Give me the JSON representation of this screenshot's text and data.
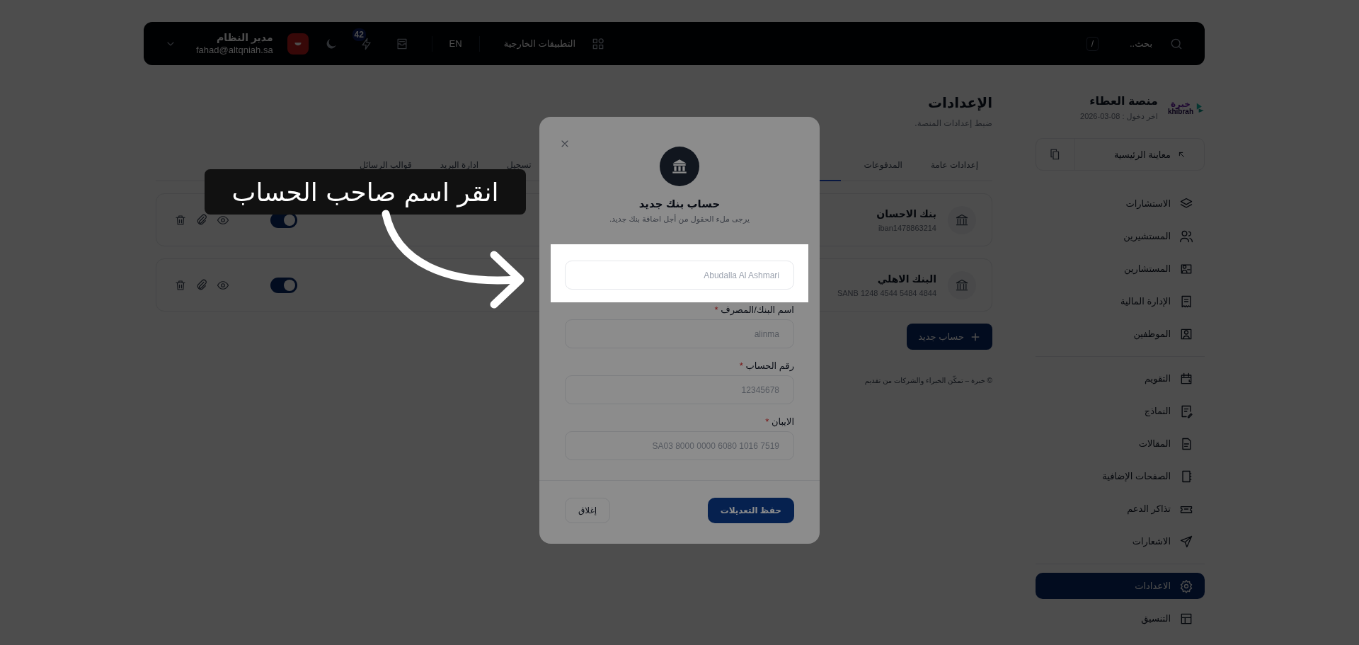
{
  "topbar": {
    "search": {
      "placeholder": "بحث..",
      "shortcut": "/"
    },
    "apps_link": "التطبيقات الخارجية",
    "language": "EN",
    "notifications_badge": "42",
    "user": {
      "name": "مدير النظام",
      "email": "fahad@altqniah.sa"
    }
  },
  "sidebar": {
    "logo_text": "خبرة",
    "logo_subtext": "khibrah",
    "title": "منصة العطاء",
    "last_login": "اخر دخول : 08-03-2026",
    "preview_button": "معاينة الرئيسية",
    "groups": [
      {
        "items": [
          {
            "label": "الاستشارات",
            "selected": false
          },
          {
            "label": "المستشيرين",
            "selected": false
          },
          {
            "label": "المستشارين",
            "selected": false
          },
          {
            "label": "الإدارة المالية",
            "selected": false
          },
          {
            "label": "الموظفين",
            "selected": false
          }
        ]
      },
      {
        "items": [
          {
            "label": "التقويم",
            "selected": false
          },
          {
            "label": "النماذج",
            "selected": false
          },
          {
            "label": "المقالات",
            "selected": false
          },
          {
            "label": "الصفحات الإضافية",
            "selected": false
          },
          {
            "label": "تذاكر الدعم",
            "selected": false
          },
          {
            "label": "الاشعارات",
            "selected": false
          }
        ]
      },
      {
        "items": [
          {
            "label": "الاعدادات",
            "selected": true
          },
          {
            "label": "التنسيق",
            "selected": false
          }
        ]
      }
    ]
  },
  "page": {
    "title": "الإعدادات",
    "subtitle": "ضبط إعدادات المنصة.",
    "tabs": [
      {
        "label": "إعدادات عامة",
        "selected": false
      },
      {
        "label": "المدفوعات",
        "selected": false
      },
      {
        "label": "تسجيل",
        "selected": false
      },
      {
        "label": "ادارة البريد",
        "selected": false
      },
      {
        "label": "قوالب الرسائل",
        "selected": false
      }
    ],
    "bank_accounts": [
      {
        "name": "بنك الاحسان",
        "iban": "iban1478863214",
        "active": true
      },
      {
        "name": "البنك الاهلي",
        "iban": "SANB 1248 4544 5484 4844",
        "active": true
      }
    ],
    "add_button": "حساب جديد",
    "footer": "© خبرة – تمكّن الخبراء والشركات من تقديم"
  },
  "modal": {
    "title": "حساب بنك جديد",
    "subtitle": "يرجى ملء الحقول من أجل اضافة بنك جديد.",
    "fields": [
      {
        "placeholder": "Abudalla Al Ashmari",
        "highlighted": true
      },
      {
        "label": "اسم البنك/المصرف",
        "required_mark": "*",
        "placeholder": "alinma",
        "highlighted": false
      },
      {
        "label": "رقم الحساب",
        "required_mark": "*",
        "placeholder": "12345678",
        "highlighted": false
      },
      {
        "label": "الايبان",
        "required_mark": "*",
        "placeholder": "SA03 8000 0000 6080 1016 7519",
        "highlighted": false
      }
    ],
    "save_button": "حفظ التعديلات",
    "close_button": "إغلاق"
  },
  "tour": {
    "callout": "انقر اسم صاحب الحساب"
  }
}
